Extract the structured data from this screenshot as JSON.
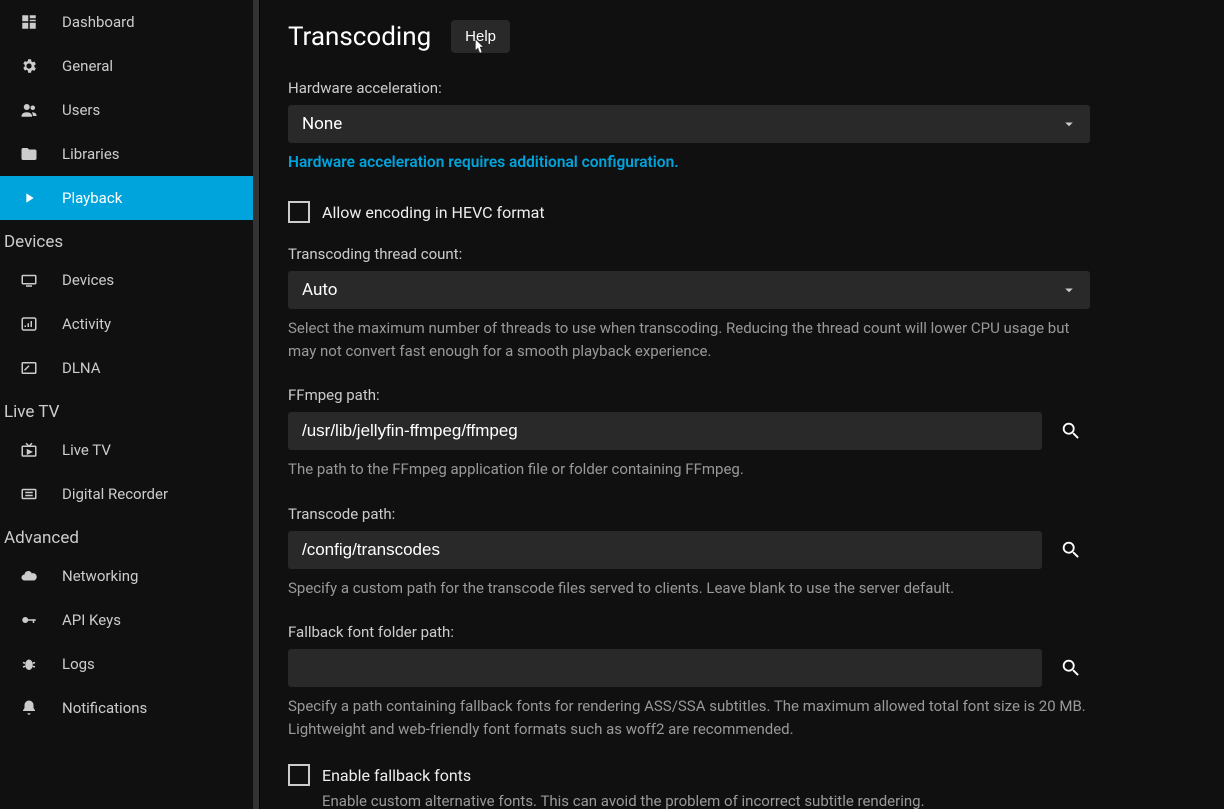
{
  "sidebar": {
    "items": [
      {
        "label": "Dashboard"
      },
      {
        "label": "General"
      },
      {
        "label": "Users"
      },
      {
        "label": "Libraries"
      },
      {
        "label": "Playback"
      }
    ],
    "devices_header": "Devices",
    "devices_items": [
      {
        "label": "Devices"
      },
      {
        "label": "Activity"
      },
      {
        "label": "DLNA"
      }
    ],
    "livetv_header": "Live TV",
    "livetv_items": [
      {
        "label": "Live TV"
      },
      {
        "label": "Digital Recorder"
      }
    ],
    "advanced_header": "Advanced",
    "advanced_items": [
      {
        "label": "Networking"
      },
      {
        "label": "API Keys"
      },
      {
        "label": "Logs"
      },
      {
        "label": "Notifications"
      }
    ]
  },
  "page": {
    "title": "Transcoding",
    "help_label": "Help"
  },
  "hw_accel": {
    "label": "Hardware acceleration:",
    "value": "None",
    "link": "Hardware acceleration requires additional configuration."
  },
  "hevc": {
    "label": "Allow encoding in HEVC format"
  },
  "threads": {
    "label": "Transcoding thread count:",
    "value": "Auto",
    "help": "Select the maximum number of threads to use when transcoding. Reducing the thread count will lower CPU usage but may not convert fast enough for a smooth playback experience."
  },
  "ffmpeg": {
    "label": "FFmpeg path:",
    "value": "/usr/lib/jellyfin-ffmpeg/ffmpeg",
    "help": "The path to the FFmpeg application file or folder containing FFmpeg."
  },
  "transcode_path": {
    "label": "Transcode path:",
    "value": "/config/transcodes",
    "help": "Specify a custom path for the transcode files served to clients. Leave blank to use the server default."
  },
  "fallback_font": {
    "label": "Fallback font folder path:",
    "value": "",
    "help": "Specify a path containing fallback fonts for rendering ASS/SSA subtitles. The maximum allowed total font size is 20 MB. Lightweight and web-friendly font formats such as woff2 are recommended."
  },
  "enable_fallback": {
    "label": "Enable fallback fonts",
    "help": "Enable custom alternative fonts. This can avoid the problem of incorrect subtitle rendering."
  }
}
